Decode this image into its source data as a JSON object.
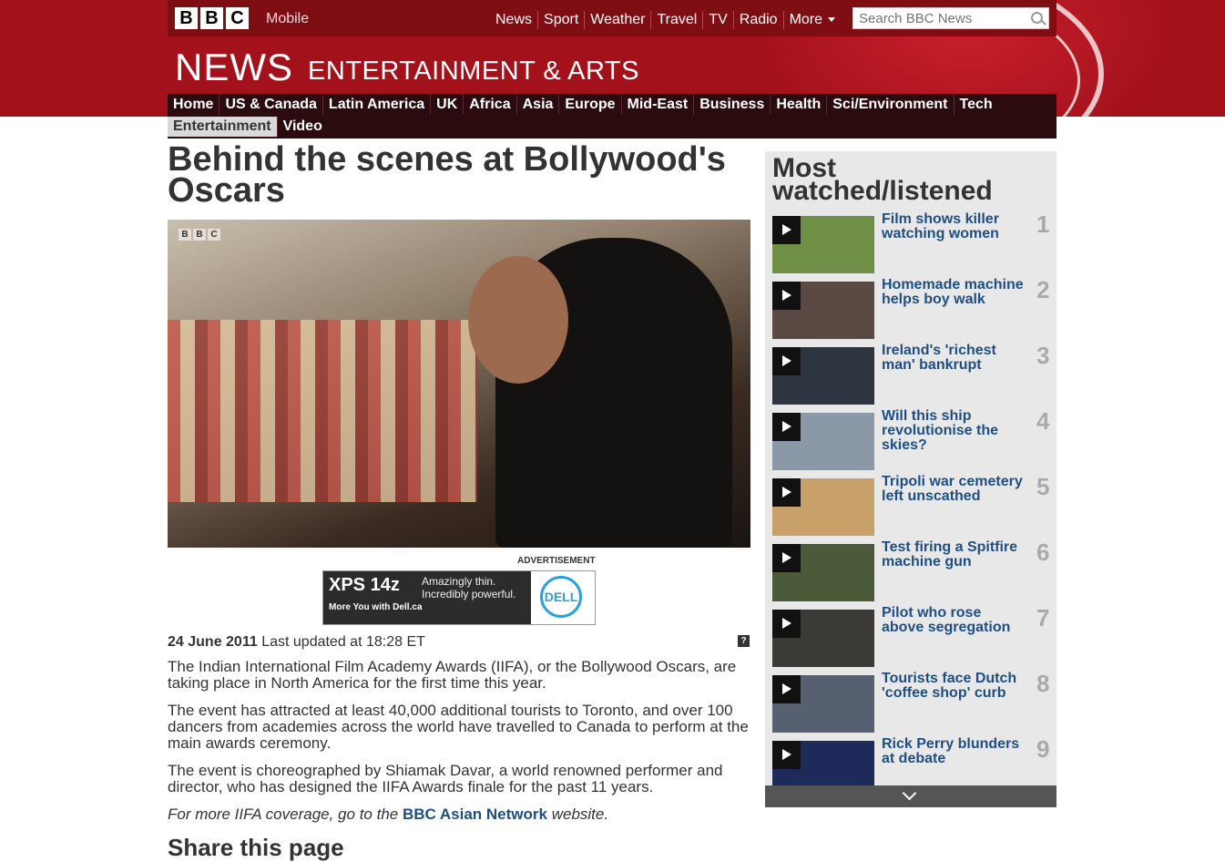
{
  "brand": {
    "bbc_letters": [
      "B",
      "B",
      "C"
    ],
    "mobile_label": "Mobile",
    "news_logo": "NEWS",
    "section_title": "ENTERTAINMENT & ARTS"
  },
  "top_nav": [
    "News",
    "Sport",
    "Weather",
    "Travel",
    "TV",
    "Radio",
    "More"
  ],
  "search": {
    "placeholder": "Search BBC News",
    "icon": "search-icon"
  },
  "main_nav": {
    "row1": [
      "Home",
      "US & Canada",
      "Latin America",
      "UK",
      "Africa",
      "Asia",
      "Europe",
      "Mid-East",
      "Business",
      "Health",
      "Sci/Environment",
      "Tech"
    ],
    "row2": [
      "Entertainment",
      "Video"
    ],
    "active": "Entertainment"
  },
  "article": {
    "headline": "Behind the scenes at Bollywood's Oscars",
    "video_watermark": [
      "B",
      "B",
      "C"
    ],
    "date": "24 June 2011",
    "updated": "Last updated at 18:28 ET",
    "help_icon_label": "?",
    "paragraphs": [
      "The Indian International Film Academy Awards (IIFA), or the Bollywood Oscars, are taking place in North America for the first time this year.",
      "The event has attracted at least 40,000 additional tourists to Toronto, and over 100 dancers from academies across the world have travelled to Canada to perform at the main awards ceremony.",
      "The event is choreographed by Shiamak Davar, a world renowned performer and director, who has designed the IIFA Awards finale for the past 11 years."
    ],
    "coverage_prefix": "For more IIFA coverage, go to the",
    "coverage_link": "BBC Asian Network",
    "coverage_suffix": "website.",
    "share_heading": "Share this page"
  },
  "advert": {
    "label": "ADVERTISEMENT",
    "product": "XPS 14z",
    "tagline": "Amazingly thin. Incredibly powerful.",
    "more": "More You with Dell.ca",
    "brand": "DELL"
  },
  "most_watched": {
    "heading": "Most watched/listened",
    "items": [
      {
        "rank": "1",
        "title": "Film shows killer watching women"
      },
      {
        "rank": "2",
        "title": "Homemade machine helps boy walk"
      },
      {
        "rank": "3",
        "title": "Ireland's 'richest man' bankrupt"
      },
      {
        "rank": "4",
        "title": "Will this ship revolutionise the skies?"
      },
      {
        "rank": "5",
        "title": "Tripoli war cemetery left unscathed"
      },
      {
        "rank": "6",
        "title": "Test firing a Spitfire machine gun"
      },
      {
        "rank": "7",
        "title": "Pilot who rose above segregation"
      },
      {
        "rank": "8",
        "title": "Tourists face Dutch 'coffee shop' curb"
      },
      {
        "rank": "9",
        "title": "Rick Perry blunders at debate"
      }
    ],
    "thumb_colors": [
      "#6f8f46",
      "#5b4a43",
      "#2d3440",
      "#8a98a8",
      "#c7a06a",
      "#4b5b3a",
      "#3c3a36",
      "#566070",
      "#1e2a5a"
    ]
  },
  "colors": {
    "masthead": "#a3111b",
    "nav_dark": "#2b0b0d",
    "link": "#1f4f82"
  }
}
